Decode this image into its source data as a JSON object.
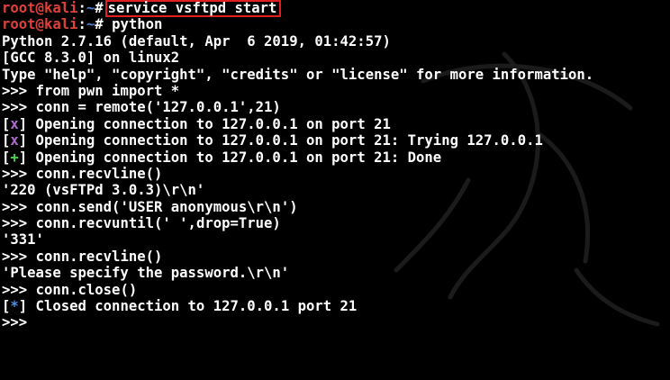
{
  "colors": {
    "background": "#000000",
    "text": "#ffffff",
    "prompt_user": "#e0403a",
    "prompt_path": "#4f7fd0",
    "highlight_box": "#e02020",
    "status_x": "#b06ad0",
    "status_plus": "#4fd04f",
    "status_star": "#5090e0"
  },
  "prompt": {
    "user": "root@kali",
    "sep": ":",
    "path": "~",
    "hash": "# "
  },
  "commands": {
    "service": "service vsftpd start",
    "python": "python"
  },
  "python_banner": [
    "Python 2.7.16 (default, Apr  6 2019, 01:42:57)",
    "[GCC 8.3.0] on linux2",
    "Type \"help\", \"copyright\", \"credits\" or \"license\" for more information."
  ],
  "repl_prompt": ">>> ",
  "lines": {
    "import": "from pwn import *",
    "remote": "conn = remote('127.0.0.1',21)",
    "status_1_sym": "x",
    "status_1_text": " Opening connection to 127.0.0.1 on port 21",
    "status_2_sym": "x",
    "status_2_text": " Opening connection to 127.0.0.1 on port 21: Trying 127.0.0.1",
    "status_3_sym": "+",
    "status_3_text": " Opening connection to 127.0.0.1 on port 21: Done",
    "recvline_1": "conn.recvline()",
    "out_220": "'220 (vsFTPd 3.0.3)\\r\\n'",
    "send_user": "conn.send('USER anonymous\\r\\n')",
    "recvuntil": "conn.recvuntil(' ',drop=True)",
    "out_331": "'331'",
    "recvline_2": "conn.recvline()",
    "out_password": "'Please specify the password.\\r\\n'",
    "close": "conn.close()",
    "status_4_sym": "*",
    "status_4_text": " Closed connection to 127.0.0.1 port 21",
    "last_prompt": ">>>"
  },
  "brackets": {
    "open": "[",
    "close": "]"
  }
}
